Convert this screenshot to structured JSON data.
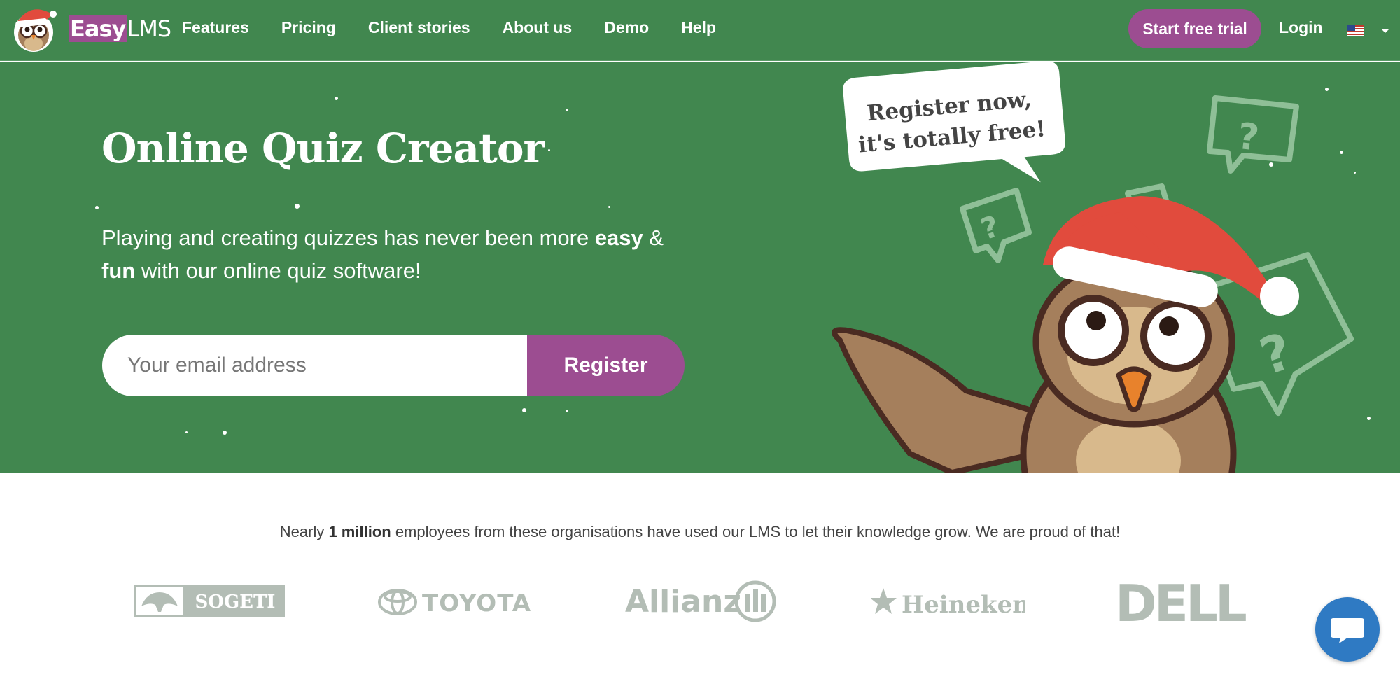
{
  "nav": {
    "logo_text_easy": "Easy",
    "logo_text_lms": "LMS",
    "links": [
      "Features",
      "Pricing",
      "Client stories",
      "About us",
      "Demo",
      "Help"
    ],
    "trial_label": "Start free trial",
    "login_label": "Login"
  },
  "hero": {
    "title": "Online Quiz Creator",
    "subtitle_1": "Playing and creating quizzes has never been more ",
    "subtitle_bold_1": "easy",
    "subtitle_2": " & ",
    "subtitle_bold_2": "fun",
    "subtitle_3": " with our online quiz software!",
    "email_placeholder": "Your email address",
    "register_label": "Register",
    "bubble_line_1": "Register now,",
    "bubble_line_2": "it's totally free!"
  },
  "clients": {
    "text_1": "Nearly ",
    "text_bold": "1 million",
    "text_2": " employees from these organisations have used our LMS to let their knowledge grow. We are proud of that!",
    "logos": [
      "SOGETI",
      "TOYOTA",
      "Allianz",
      "Heineken",
      "DELL"
    ]
  },
  "colors": {
    "nav_green": "#41874f",
    "accent_purple": "#9c4d91",
    "logo_gray": "#b3bdb5",
    "chat_blue": "#2f7ac3"
  }
}
